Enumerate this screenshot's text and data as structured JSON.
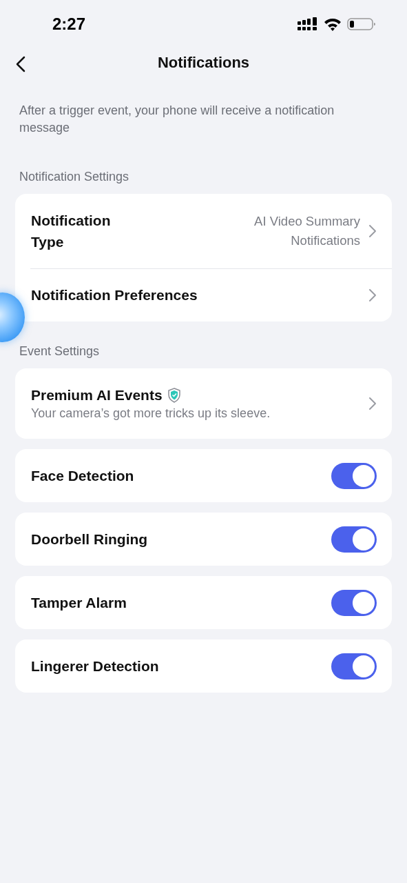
{
  "status_bar": {
    "time": "2:27"
  },
  "nav": {
    "title": "Notifications"
  },
  "description": "After a trigger event, your phone will receive a notification message",
  "sections": [
    {
      "title": "Notification Settings",
      "cards": [
        {
          "rows": [
            {
              "kind": "link",
              "label": "Notification Type",
              "value": "AI Video Summary Notifications"
            },
            {
              "kind": "link",
              "label": "Notification Preferences"
            }
          ]
        }
      ]
    },
    {
      "title": "Event Settings",
      "cards": [
        {
          "rows": [
            {
              "kind": "premium",
              "label": "Premium AI Events",
              "subtitle": "Your camera’s got more tricks up its sleeve."
            }
          ]
        },
        {
          "rows": [
            {
              "kind": "toggle",
              "label": "Face Detection",
              "on": true
            }
          ]
        },
        {
          "rows": [
            {
              "kind": "toggle",
              "label": "Doorbell Ringing",
              "on": true
            }
          ]
        },
        {
          "rows": [
            {
              "kind": "toggle",
              "label": "Tamper Alarm",
              "on": true
            }
          ]
        },
        {
          "rows": [
            {
              "kind": "toggle",
              "label": "Lingerer Detection",
              "on": true
            }
          ]
        }
      ]
    }
  ]
}
